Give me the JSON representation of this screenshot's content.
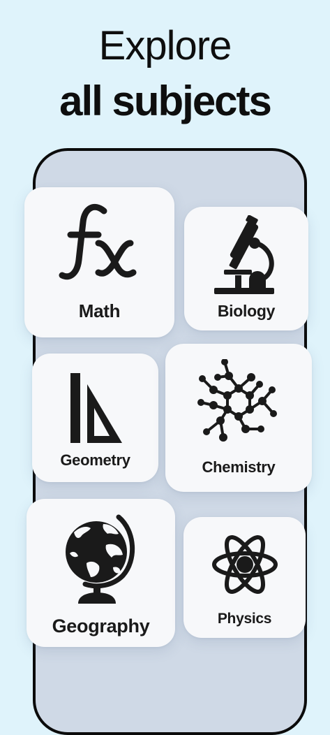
{
  "headline": {
    "line1": "Explore",
    "line2": "all subjects"
  },
  "colors": {
    "background": "#dff3fb",
    "phone_screen": "#cfd9e6",
    "card": "#f7f8fa",
    "icon": "#1a1a1a"
  },
  "subjects": [
    {
      "label": "Math",
      "icon": "function-fx-icon"
    },
    {
      "label": "Biology",
      "icon": "microscope-icon"
    },
    {
      "label": "Geometry",
      "icon": "ruler-triangle-icon"
    },
    {
      "label": "Chemistry",
      "icon": "molecule-icon"
    },
    {
      "label": "Geography",
      "icon": "globe-icon"
    },
    {
      "label": "Physics",
      "icon": "atom-icon"
    }
  ]
}
